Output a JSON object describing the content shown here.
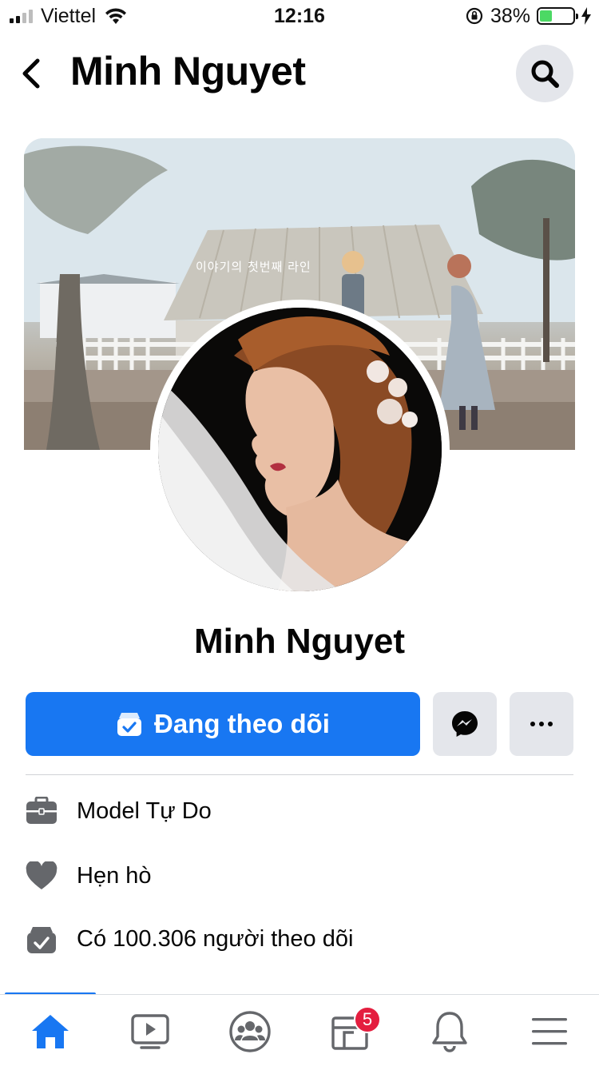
{
  "status_bar": {
    "carrier": "Viettel",
    "time": "12:16",
    "battery_percent": "38%",
    "battery_level": 0.38
  },
  "header": {
    "title": "Minh Nguyet",
    "back_icon": "chevron-left-icon",
    "search_icon": "search-icon"
  },
  "cover": {
    "overlay_text": "이야기의 첫번째 라인"
  },
  "profile": {
    "name": "Minh Nguyet"
  },
  "actions": {
    "follow_label": "Đang theo dõi",
    "follow_icon": "following-check-icon",
    "message_icon": "messenger-icon",
    "more_icon": "more-dots-icon",
    "accent_color": "#1877f2"
  },
  "info": {
    "items": [
      {
        "icon": "briefcase-icon",
        "label": "Model Tự Do"
      },
      {
        "icon": "heart-icon",
        "label": "Hẹn hò"
      },
      {
        "icon": "followers-check-icon",
        "label": "Có 100.306 người theo dõi"
      }
    ]
  },
  "tabbar": {
    "tabs": [
      {
        "name": "home",
        "icon": "home-icon",
        "active": true
      },
      {
        "name": "watch",
        "icon": "video-play-icon",
        "active": false
      },
      {
        "name": "groups",
        "icon": "groups-icon",
        "active": false
      },
      {
        "name": "pages",
        "icon": "pages-icon",
        "active": false,
        "badge": "5"
      },
      {
        "name": "notifications",
        "icon": "bell-icon",
        "active": false
      },
      {
        "name": "menu",
        "icon": "hamburger-menu-icon",
        "active": false
      }
    ]
  }
}
